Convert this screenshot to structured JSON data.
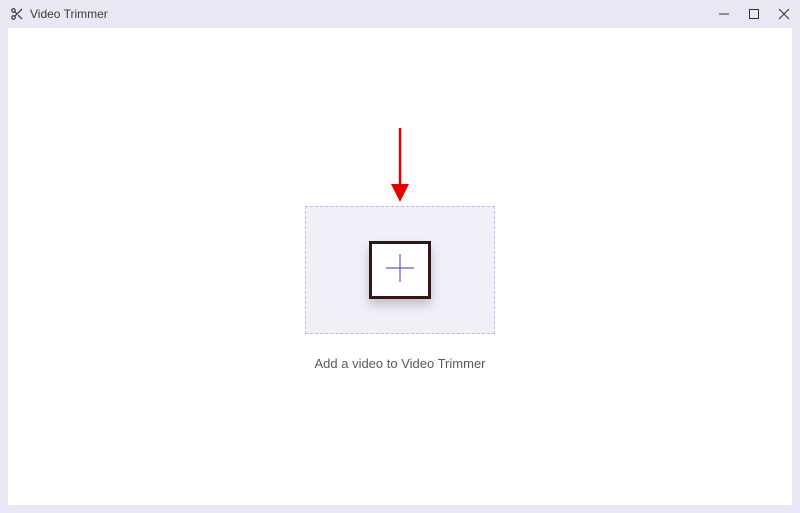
{
  "titlebar": {
    "title": "Video Trimmer"
  },
  "main": {
    "instruction": "Add a video to Video Trimmer"
  },
  "icons": {
    "app": "scissors-icon",
    "add": "plus-icon"
  },
  "colors": {
    "accent": "#6456d1",
    "outer_bg": "#e8e7f3",
    "inner_bg": "#ffffff",
    "dropzone_bg": "#f1f0f9",
    "dropzone_border": "#bdb9df",
    "annotation_arrow": "#e30000",
    "highlight_box": "#301616"
  }
}
